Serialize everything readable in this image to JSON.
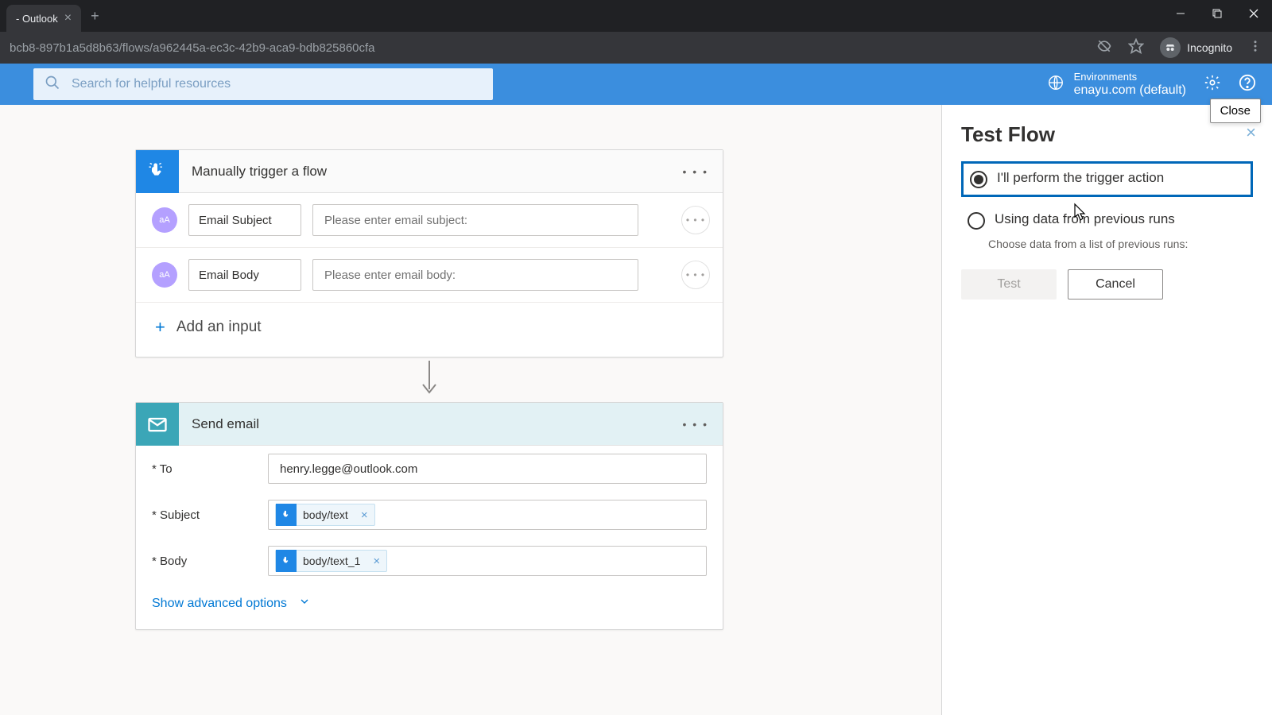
{
  "browser": {
    "tab_title": "- Outlook",
    "url": "bcb8-897b1a5d8b63/flows/a962445a-ec3c-42b9-aca9-bdb825860cfa",
    "incognito_label": "Incognito"
  },
  "header": {
    "search_placeholder": "Search for helpful resources",
    "env_label": "Environments",
    "env_name": "enayu.com (default)",
    "close_tooltip": "Close"
  },
  "trigger_card": {
    "title": "Manually trigger a flow",
    "inputs": [
      {
        "avatar": "aA",
        "name": "Email Subject",
        "placeholder": "Please enter email subject:"
      },
      {
        "avatar": "aA",
        "name": "Email Body",
        "placeholder": "Please enter email body:"
      }
    ],
    "add_input_label": "Add an input"
  },
  "action_card": {
    "title": "Send email",
    "fields": {
      "to_label": "* To",
      "to_value": "henry.legge@outlook.com",
      "subject_label": "* Subject",
      "subject_token": "body/text",
      "body_label": "* Body",
      "body_token": "body/text_1"
    },
    "show_advanced": "Show advanced options"
  },
  "panel": {
    "title": "Test Flow",
    "option1": "I'll perform the trigger action",
    "option2": "Using data from previous runs",
    "option2_sub": "Choose data from a list of previous runs:",
    "test_btn": "Test",
    "cancel_btn": "Cancel"
  }
}
